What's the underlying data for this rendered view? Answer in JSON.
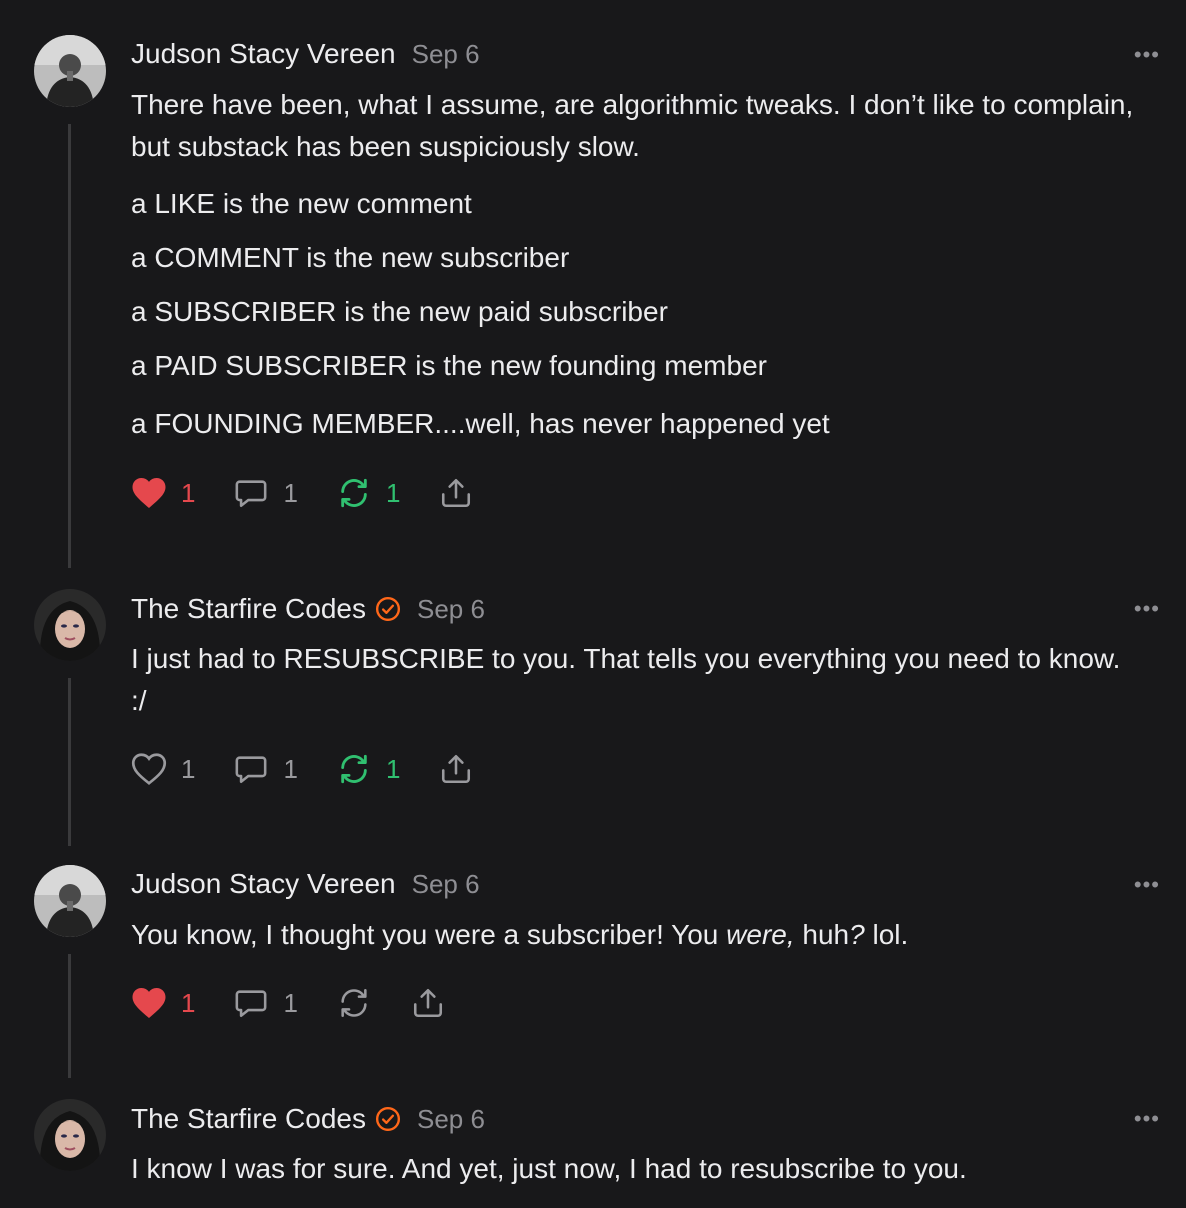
{
  "comments": [
    {
      "author": "Judson Stacy Vereen",
      "date": "Sep 6",
      "verified": false,
      "more": "•••",
      "paragraphs": [
        "There have been, what I assume, are algorithmic tweaks. I don’t like to complain, but substack has been suspiciously slow."
      ],
      "lines": [
        "a LIKE is the new comment",
        "a COMMENT is the new subscriber",
        "a SUBSCRIBER is the new paid subscriber",
        "a PAID SUBSCRIBER is the new founding member",
        "a FOUNDING MEMBER....well, has never happened yet"
      ],
      "likes": "1",
      "liked": true,
      "replies": "1",
      "restacks": "1",
      "restacked": true
    },
    {
      "author": "The Starfire Codes",
      "date": "Sep 6",
      "verified": true,
      "more": "•••",
      "paragraphs": [
        "I just had to RESUBSCRIBE to you. That tells you everything you need to know. :/"
      ],
      "likes": "1",
      "liked": false,
      "replies": "1",
      "restacks": "1",
      "restacked": true
    },
    {
      "author": "Judson Stacy Vereen",
      "date": "Sep 6",
      "verified": false,
      "more": "•••",
      "text_before": "You know, I thought you were a subscriber! You ",
      "text_italic_1": "were,",
      "text_mid": " huh",
      "text_italic_2": "?",
      "text_after": " lol.",
      "likes": "1",
      "liked": true,
      "replies": "1",
      "restacks": "",
      "restacked": false
    },
    {
      "author": "The Starfire Codes",
      "date": "Sep 6",
      "verified": true,
      "more": "•••",
      "paragraphs": [
        "I know I was for sure. And yet, just now, I had to resubscribe to you."
      ]
    }
  ],
  "colors": {
    "background": "#18181a",
    "liked_red": "#e5484d",
    "restack_green": "#30c070",
    "verified_orange": "#ff6719",
    "muted": "#8e8e93"
  },
  "icons": [
    "heart-icon",
    "comment-icon",
    "restack-icon",
    "share-icon",
    "verified-icon",
    "more-icon"
  ]
}
